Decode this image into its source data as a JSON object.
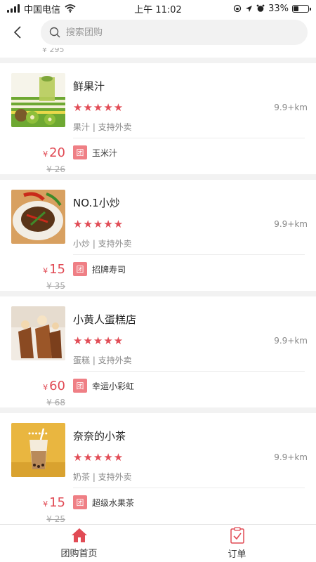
{
  "status_bar": {
    "carrier": "中国电信",
    "time": "上午 11:02",
    "battery": "33%",
    "battery_level": 0.33
  },
  "header": {
    "search_placeholder": "搜索团购"
  },
  "partial_item": {
    "original_price": "¥ 295"
  },
  "shops": [
    {
      "name": "鲜果汁",
      "rating": 5,
      "distance": "9.9+km",
      "tags": "果汁 | 支持外卖",
      "price_symbol": "¥",
      "price": "20",
      "original_price": "¥ 26",
      "deal_badge": "团",
      "deal_name": "玉米汁",
      "image": "kiwi-juice-image"
    },
    {
      "name": "NO.1小炒",
      "rating": 5,
      "distance": "9.9+km",
      "tags": "小炒 | 支持外卖",
      "price_symbol": "¥",
      "price": "15",
      "original_price": "¥ 35",
      "deal_badge": "团",
      "deal_name": "招牌寿司",
      "image": "stir-fry-image"
    },
    {
      "name": "小黄人蛋糕店",
      "rating": 5,
      "distance": "9.9+km",
      "tags": "蛋糕 | 支持外卖",
      "price_symbol": "¥",
      "price": "60",
      "original_price": "¥ 68",
      "deal_badge": "团",
      "deal_name": "幸运小彩虹",
      "image": "cake-image"
    },
    {
      "name": "奈奈的小茶",
      "rating": 5,
      "distance": "9.9+km",
      "tags": "奶茶 | 支持外卖",
      "price_symbol": "¥",
      "price": "15",
      "original_price": "¥ 25",
      "deal_badge": "团",
      "deal_name": "超级水果茶",
      "image": "milk-tea-image"
    }
  ],
  "tabbar": {
    "home_label": "团购首页",
    "orders_label": "订单"
  },
  "colors": {
    "accent": "#e14b55",
    "badge": "#ef7f85"
  }
}
